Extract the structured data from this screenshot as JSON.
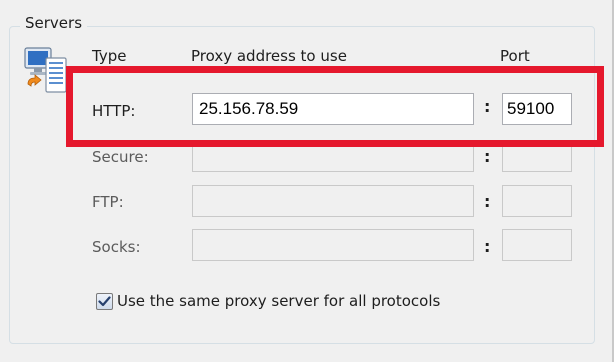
{
  "group": {
    "title": "Servers"
  },
  "columns": {
    "type": "Type",
    "address": "Proxy address to use",
    "port": "Port"
  },
  "rows": [
    {
      "label": "HTTP:",
      "address": "25.156.78.59",
      "port": "59100",
      "enabled": true
    },
    {
      "label": "Secure:",
      "address": "",
      "port": "",
      "enabled": false
    },
    {
      "label": "FTP:",
      "address": "",
      "port": "",
      "enabled": false
    },
    {
      "label": "Socks:",
      "address": "",
      "port": "",
      "enabled": false
    }
  ],
  "separator": ":",
  "same_proxy": {
    "label": "Use the same proxy server for all protocols",
    "checked": true
  },
  "colors": {
    "highlight": "#e5182d",
    "background": "#f0f0f0",
    "field_border": "#abadb3"
  },
  "icons": {
    "servers": "servers-network-icon",
    "checkmark": "checkmark-icon"
  }
}
